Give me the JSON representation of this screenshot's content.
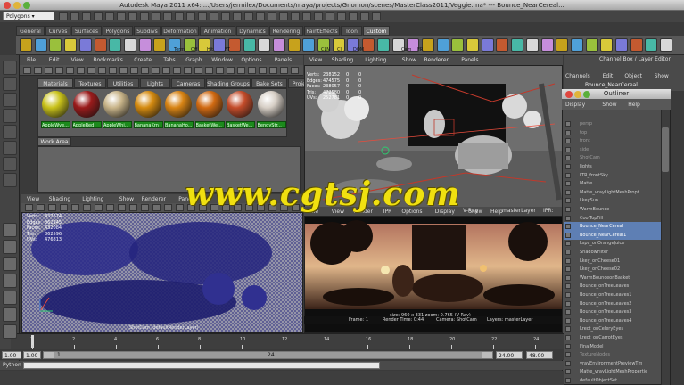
{
  "window": {
    "title": "Autodesk Maya 2011 x64: .../Users/jermilex/Documents/maya/projects/Gnomon/scenes/MasterClass2011/Veggie.ma*    ---    Bounce_NearCereal..."
  },
  "statusline": {
    "mode_select": "Polygons"
  },
  "shelf": {
    "tabs": [
      "General",
      "Curves",
      "Surfaces",
      "Polygons",
      "Subdivs",
      "Deformation",
      "Animation",
      "Dynamics",
      "Rendering",
      "PaintEffects",
      "Toon",
      "Custom"
    ],
    "active_tab": "Custom",
    "buttons": [
      "Term",
      "Off",
      "Hit",
      "FT",
      "CLN",
      "Cl",
      "DOM",
      "Cam",
      "FR"
    ]
  },
  "hypershade": {
    "menu": [
      "File",
      "Edit",
      "View",
      "Bookmarks",
      "Create",
      "Tabs",
      "Graph",
      "Window",
      "Options",
      "Panels"
    ],
    "tabs": [
      "Materials",
      "Textures",
      "Utilities",
      "Lights",
      "Cameras",
      "Shading Groups",
      "Bake Sets",
      "Projec"
    ],
    "active_tab": "Materials",
    "swatches": [
      {
        "label": "AppleWye...",
        "color": "#c9c21a"
      },
      {
        "label": "AppleRed",
        "color": "#9a1b1b"
      },
      {
        "label": "AppleWhi...",
        "color": "#c9b58a"
      },
      {
        "label": "BananaKrn",
        "color": "#d58b10"
      },
      {
        "label": "BananaHo...",
        "color": "#d88414"
      },
      {
        "label": "BasketWe...",
        "color": "#d16a12"
      },
      {
        "label": "BasketWe...",
        "color": "#c44c2a"
      },
      {
        "label": "BendyStr...",
        "color": "#d7cfc6"
      }
    ],
    "work_area_label": "Work Area"
  },
  "viewport_top": {
    "menu": [
      "View",
      "Shading",
      "Lighting",
      "Show",
      "Renderer",
      "Panels"
    ],
    "stats": [
      {
        "label": "Verts:",
        "a": "238152",
        "b": "0",
        "c": "0"
      },
      {
        "label": "Edges:",
        "a": "474575",
        "b": "0",
        "c": "0"
      },
      {
        "label": "Faces:",
        "a": "238057",
        "b": "0",
        "c": "0"
      },
      {
        "label": "Tris:",
        "a": "472580",
        "b": "0",
        "c": "0"
      },
      {
        "label": "UVs:",
        "a": "252781",
        "b": "0",
        "c": "0"
      }
    ]
  },
  "viewport_bottom_left": {
    "menu": [
      "View",
      "Shading",
      "Lighting",
      "Show",
      "Renderer",
      "Panels"
    ],
    "stats": [
      {
        "label": "Verts:",
        "a": "432674"
      },
      {
        "label": "Edges:",
        "a": "862945"
      },
      {
        "label": "Faces:",
        "a": "432084"
      },
      {
        "label": "Tris:",
        "a": "862596"
      },
      {
        "label": "UVs:",
        "a": "476813"
      }
    ],
    "camera_label": "ShotCam (defaultRenderLayer)"
  },
  "render_view": {
    "menu": [
      "File",
      "View",
      "Render",
      "IPR",
      "Options",
      "Display",
      "Show",
      "Help"
    ],
    "renderer_select": "V-Ray",
    "layer_select": "masterLayer",
    "ipr_label": "IPR:",
    "caption": "size: 960 x 331  zoom: 0.765    (V-Ray)",
    "status": {
      "frame": "Frame: 1",
      "render_time": "Render Time: 0:44",
      "camera": "Camera: ShotCam",
      "layers": "Layers: masterLayer"
    }
  },
  "channel_box": {
    "header": "Channel Box / Layer Editor",
    "menu": [
      "Channels",
      "Edit",
      "Object",
      "Show"
    ],
    "selected_node": "Bounce_NearCereal"
  },
  "outliner": {
    "title": "Outliner",
    "menu": [
      "Display",
      "Show",
      "Help"
    ],
    "items": [
      {
        "label": "persp",
        "state": "dim"
      },
      {
        "label": "top",
        "state": "dim"
      },
      {
        "label": "front",
        "state": "dim"
      },
      {
        "label": "side",
        "state": "dim"
      },
      {
        "label": "ShotCam",
        "state": "dim"
      },
      {
        "label": "lights",
        "state": "lit"
      },
      {
        "label": "LTR_frontSky",
        "state": "lit"
      },
      {
        "label": "Matte",
        "state": "lit"
      },
      {
        "label": "Matte_vrayLightMeshPropt",
        "state": "lit"
      },
      {
        "label": "LkeySun",
        "state": "lit"
      },
      {
        "label": "WarmBounce",
        "state": "lit"
      },
      {
        "label": "CoolTopFill",
        "state": "lit"
      },
      {
        "label": "Bounce_NearCereal",
        "state": "sel"
      },
      {
        "label": "Bounce_NearCereal1",
        "state": "sel"
      },
      {
        "label": "Lspc_onOrangeJuice",
        "state": "lit"
      },
      {
        "label": "ShadowFilter",
        "state": "lit"
      },
      {
        "label": "Lkey_onCheese01",
        "state": "lit"
      },
      {
        "label": "Lkey_onCheese02",
        "state": "lit"
      },
      {
        "label": "WarmBounceonBasket",
        "state": "lit"
      },
      {
        "label": "Bounce_onTreeLeaves",
        "state": "lit"
      },
      {
        "label": "Bounce_onTreeLeaves1",
        "state": "lit"
      },
      {
        "label": "Bounce_onTreeLeaves2",
        "state": "lit"
      },
      {
        "label": "Bounce_onTreeLeaves3",
        "state": "lit"
      },
      {
        "label": "Bounce_onTreeLeaves4",
        "state": "lit"
      },
      {
        "label": "Lrect_onCeleryEyes",
        "state": "lit"
      },
      {
        "label": "Lrect_onCarrotEyes",
        "state": "lit"
      },
      {
        "label": "FinalModel",
        "state": "lit"
      },
      {
        "label": "TextureNodes",
        "state": "dim"
      },
      {
        "label": "vrayEnvironmentPreviewTm",
        "state": "lit"
      },
      {
        "label": "Matte_vrayLightMeshPropertie",
        "state": "lit"
      },
      {
        "label": "defaultObjectSet",
        "state": "lit"
      }
    ]
  },
  "timeline": {
    "ticks": [
      "1",
      "2",
      "4",
      "6",
      "8",
      "10",
      "12",
      "14",
      "16",
      "18",
      "20",
      "22",
      "24"
    ],
    "range": {
      "start": "1.00",
      "inner_start": "1.00",
      "inner_value": "1",
      "inner_end": "24",
      "end": "24.00",
      "max": "48.00"
    }
  },
  "command_line": {
    "label": "Python"
  },
  "watermark": {
    "text": "www.cgtsj.com"
  }
}
